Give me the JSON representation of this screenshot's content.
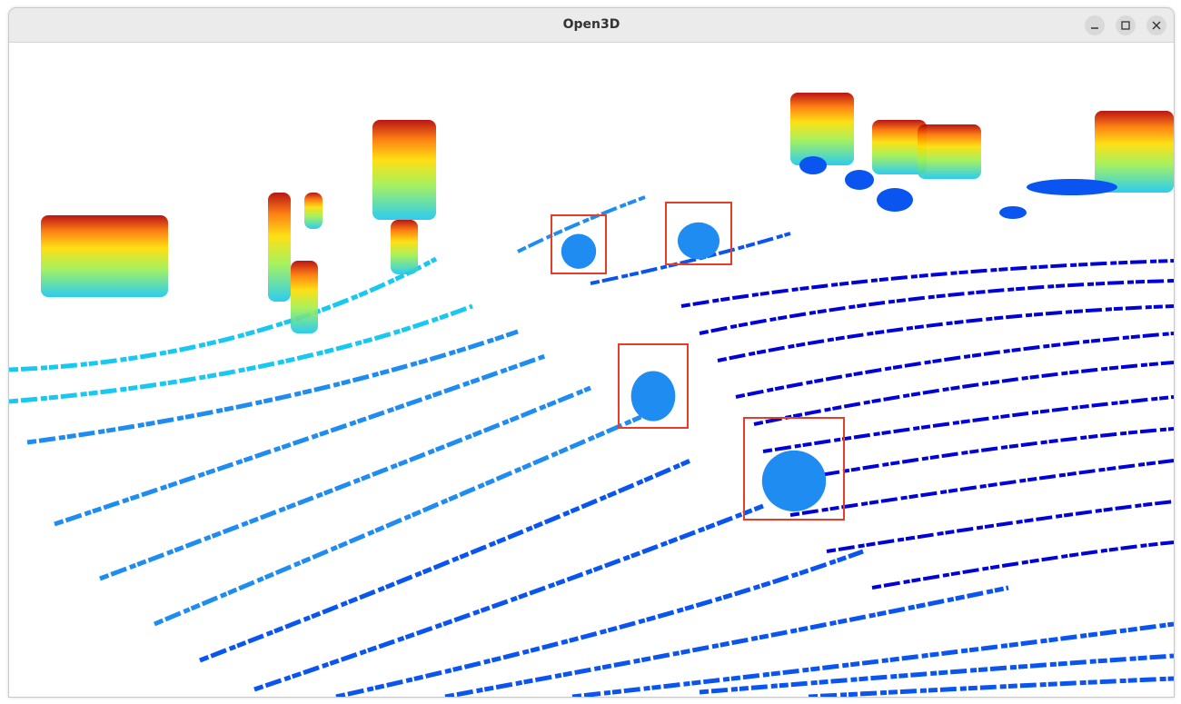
{
  "window": {
    "title": "Open3D",
    "controls": [
      "minimize-icon",
      "maximize-icon",
      "close-icon"
    ]
  },
  "viewport": {
    "background": "#ffffff",
    "colormap": [
      "#0000d8",
      "#0a55f0",
      "#1e8cf0",
      "#19c8f0",
      "#28e6c8",
      "#a0f050",
      "#ffdc00",
      "#ff7800",
      "#e61e00",
      "#b40000"
    ],
    "bbox_color": "#e63c28",
    "bounding_boxes_count": 4
  }
}
